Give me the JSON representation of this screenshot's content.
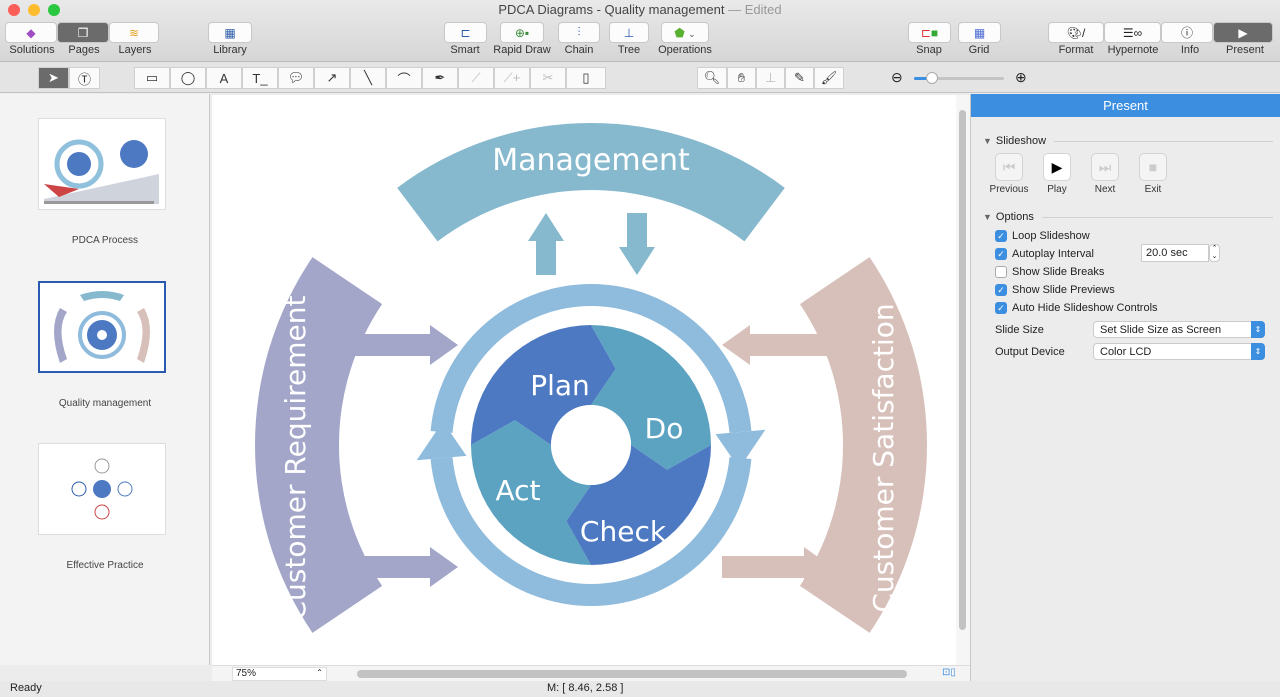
{
  "window": {
    "title": "PDCA Diagrams - Quality management",
    "edited": "— Edited"
  },
  "toolbar": {
    "solutions": "Solutions",
    "pages": "Pages",
    "layers": "Layers",
    "library": "Library",
    "smart": "Smart",
    "rapid_draw": "Rapid Draw",
    "chain": "Chain",
    "tree": "Tree",
    "operations": "Operations",
    "snap": "Snap",
    "grid": "Grid",
    "format": "Format",
    "hypernote": "Hypernote",
    "info": "Info",
    "present": "Present"
  },
  "zoom_slider": {
    "value": 0.2
  },
  "pages": [
    {
      "label": "PDCA Process"
    },
    {
      "label": "Quality management",
      "selected": true
    },
    {
      "label": "Effective Practice"
    }
  ],
  "diagram": {
    "top": "Management",
    "left": "Customer Requirement",
    "right": "Customer Satisfaction",
    "segments": [
      "Plan",
      "Do",
      "Check",
      "Act"
    ],
    "colors": {
      "management": "#86b9ce",
      "requirement": "#a3a6c9",
      "satisfaction": "#d8c0ba",
      "ring": "#8fbbdc",
      "plan_check": "#4d79c2",
      "do_act": "#5ca3c2"
    }
  },
  "panel": {
    "title": "Present",
    "slideshow": "Slideshow",
    "buttons": [
      "Previous",
      "Play",
      "Next",
      "Exit"
    ],
    "options": "Options",
    "checks": [
      {
        "label": "Loop Slideshow",
        "checked": true
      },
      {
        "label": "Autoplay Interval",
        "checked": true
      },
      {
        "label": "Show Slide Breaks",
        "checked": false
      },
      {
        "label": "Show Slide Previews",
        "checked": true
      },
      {
        "label": "Auto Hide Slideshow Controls",
        "checked": true
      }
    ],
    "interval": "20.0 sec",
    "slide_size_label": "Slide Size",
    "slide_size": "Set Slide Size as Screen",
    "output_label": "Output Device",
    "output": "Color LCD"
  },
  "status": {
    "left": "Ready",
    "coords": "M: [ 8.46, 2.58 ]",
    "zoom": "75%"
  }
}
